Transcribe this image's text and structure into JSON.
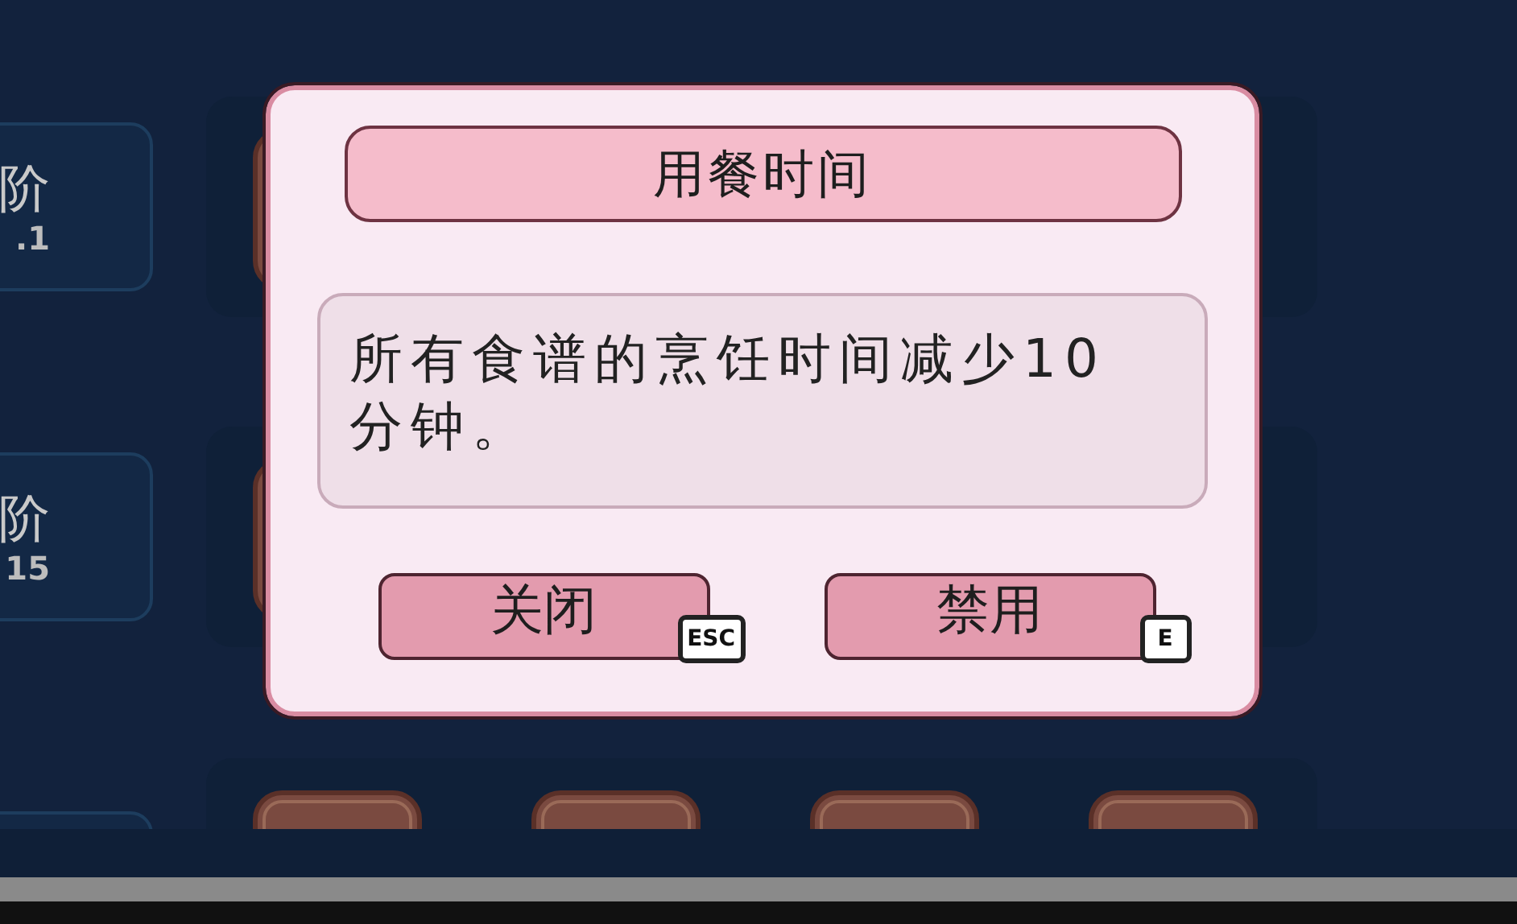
{
  "background": {
    "tiers": [
      {
        "label": "阶",
        "value": ".1"
      },
      {
        "label": "阶",
        "value": "15"
      }
    ]
  },
  "dialog": {
    "title": "用餐时间",
    "description": "所有食谱的烹饪时间减少10分钟。",
    "buttons": [
      {
        "label": "关闭",
        "key": "ESC"
      },
      {
        "label": "禁用",
        "key": "E"
      }
    ]
  }
}
